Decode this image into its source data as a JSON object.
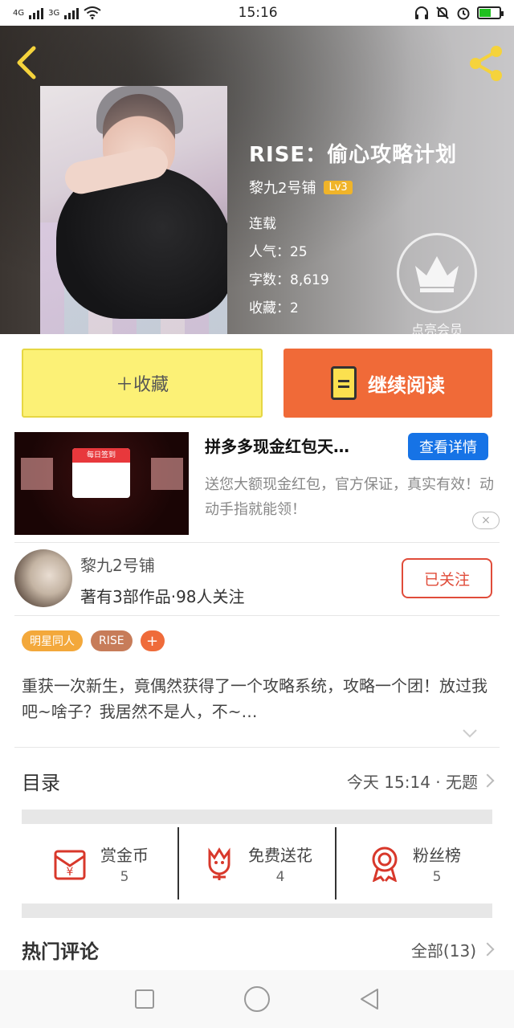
{
  "status_bar": {
    "network_left": "4G",
    "network_right": "3G",
    "time": "15:16"
  },
  "book": {
    "title": "RISE：偷心攻略计划",
    "author": "黎九2号铺",
    "level": "Lv3",
    "status": "连载",
    "popularity": "人气：25",
    "word_count": "字数：8,619",
    "collections": "收藏：2",
    "vip_label": "点亮会员"
  },
  "actions": {
    "collect_label": "＋收藏",
    "read_label": "继续阅读"
  },
  "ad": {
    "thumb_text": "每日签到",
    "title": "拼多多现金红包天…",
    "detail_button": "查看详情",
    "description": "送您大额现金红包，官方保证，真实有效！动动手指就能领！",
    "close": "×"
  },
  "author_row": {
    "name": "黎九2号铺",
    "subtitle": "著有3部作品·98人关注",
    "follow_button": "已关注"
  },
  "tags": [
    "明星同人",
    "RISE",
    "+"
  ],
  "summary": "重获一次新生，竟偶然获得了一个攻略系统，攻略一个团！放过我吧~啥子？我居然不是人，不~…",
  "catalog": {
    "title": "目录",
    "latest": "今天 15:14 · 无题"
  },
  "stats": [
    {
      "label": "赏金币",
      "count": "5",
      "icon": "gold-coin-icon"
    },
    {
      "label": "免费送花",
      "count": "4",
      "icon": "flower-icon"
    },
    {
      "label": "粉丝榜",
      "count": "5",
      "icon": "medal-icon"
    }
  ],
  "comments": {
    "title": "热门评论",
    "all": "全部(13)"
  },
  "colors": {
    "collect_bg": "#fcf176",
    "read_bg": "#f06a38",
    "detail_bg": "#1673e6",
    "follow_color": "#e04c3a",
    "level_badge": "#f0b429",
    "icon_accent": "#f0b429"
  }
}
